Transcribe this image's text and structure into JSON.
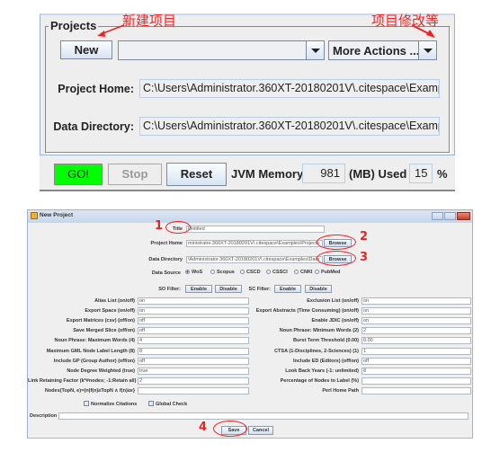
{
  "top_panel": {
    "group_title": "Projects",
    "new_button": "New",
    "project_combo_value": "",
    "more_actions": "More Actions ...",
    "project_home_label": "Project Home:",
    "project_home_value": "C:\\Users\\Administrator.360XT-20180201V\\.citespace\\Examp",
    "data_directory_label": "Data Directory:",
    "data_directory_value": "C:\\Users\\Administrator.360XT-20180201V\\.citespace\\Examp",
    "annotation_new": "新建项目",
    "annotation_more": "项目修改等"
  },
  "bottom_bar": {
    "go_button": "GO!",
    "stop_button": "Stop",
    "reset_button": "Reset",
    "jvm_label": "JVM Memory",
    "jvm_value": "981",
    "used_label": "(MB) Used",
    "used_value": "15",
    "percent": "%"
  },
  "dialog": {
    "title": "New Project",
    "title_label": "Title",
    "title_value": "Untitled",
    "project_home_label": "Project Home",
    "project_home_value": "ministrator.360XT-20180201V\\.citespace\\Examples\\Projects",
    "data_directory_label": "Data Directory",
    "data_directory_value": "\\Administrator.360XT-20180201V\\.citespace\\Examples\\Data",
    "browse": "Browse",
    "data_source_label": "Data Source",
    "data_sources": [
      {
        "label": "WoS",
        "selected": true
      },
      {
        "label": "Scopus",
        "selected": false
      },
      {
        "label": "CSCD",
        "selected": false
      },
      {
        "label": "CSSCI",
        "selected": false
      },
      {
        "label": "CNKI",
        "selected": false
      },
      {
        "label": "PubMed",
        "selected": false
      }
    ],
    "so_filter_label": "SO Filter:",
    "sc_filter_label": "SC Filter:",
    "enable": "Enable",
    "disable": "Disable",
    "left_fields": [
      {
        "label": "Alias List (on/off)",
        "value": "on"
      },
      {
        "label": "Export Space (on/off)",
        "value": "on"
      },
      {
        "label": "Export Matrices (csv) (off/on)",
        "value": "off"
      },
      {
        "label": "Save Merged Slice (off/on)",
        "value": "off"
      },
      {
        "label": "Noun Phrase: Maximum Words (4)",
        "value": "4"
      },
      {
        "label": "Maximum GML Node Label Length (8)",
        "value": "8"
      },
      {
        "label": "Include GP (Group Author) (off/on)",
        "value": "off"
      },
      {
        "label": "Node Degree Weighted (true)",
        "value": "true"
      },
      {
        "label": "Link Retaining Factor (k*#nodes; -1:Retain all)",
        "value": "2"
      },
      {
        "label": "Nodes(TopN, e)={n|f(n)≥TopN ∧ f(n)≥e}",
        "value": ""
      }
    ],
    "right_fields": [
      {
        "label": "Exclusion List (on/off)",
        "value": "on"
      },
      {
        "label": "Export Abstracts (Time Consuming) (on/off)",
        "value": "on"
      },
      {
        "label": "Enable JDIC (on/off)",
        "value": "on"
      },
      {
        "label": "Noun Phrase: Minimum Words (2)",
        "value": "2"
      },
      {
        "label": "Burst Term Threshold (0.00)",
        "value": "0.00"
      },
      {
        "label": "CTSA (1-Disciplines, 2-Sciences) (1)",
        "value": "1"
      },
      {
        "label": "Include ED (Editors) (off/on)",
        "value": "off"
      },
      {
        "label": "Look Back Years (-1: unlimited)",
        "value": "8"
      },
      {
        "label": "Percentage of Nodes to Label (%)",
        "value": ""
      },
      {
        "label": "Perl Home Path",
        "value": ""
      }
    ],
    "normalize_citations": "Normalize Citations",
    "global_check": "Global Check",
    "description_label": "Description",
    "description_value": "",
    "save": "Save",
    "cancel": "Cancel",
    "annotations": [
      "1",
      "2",
      "3",
      "4"
    ]
  }
}
